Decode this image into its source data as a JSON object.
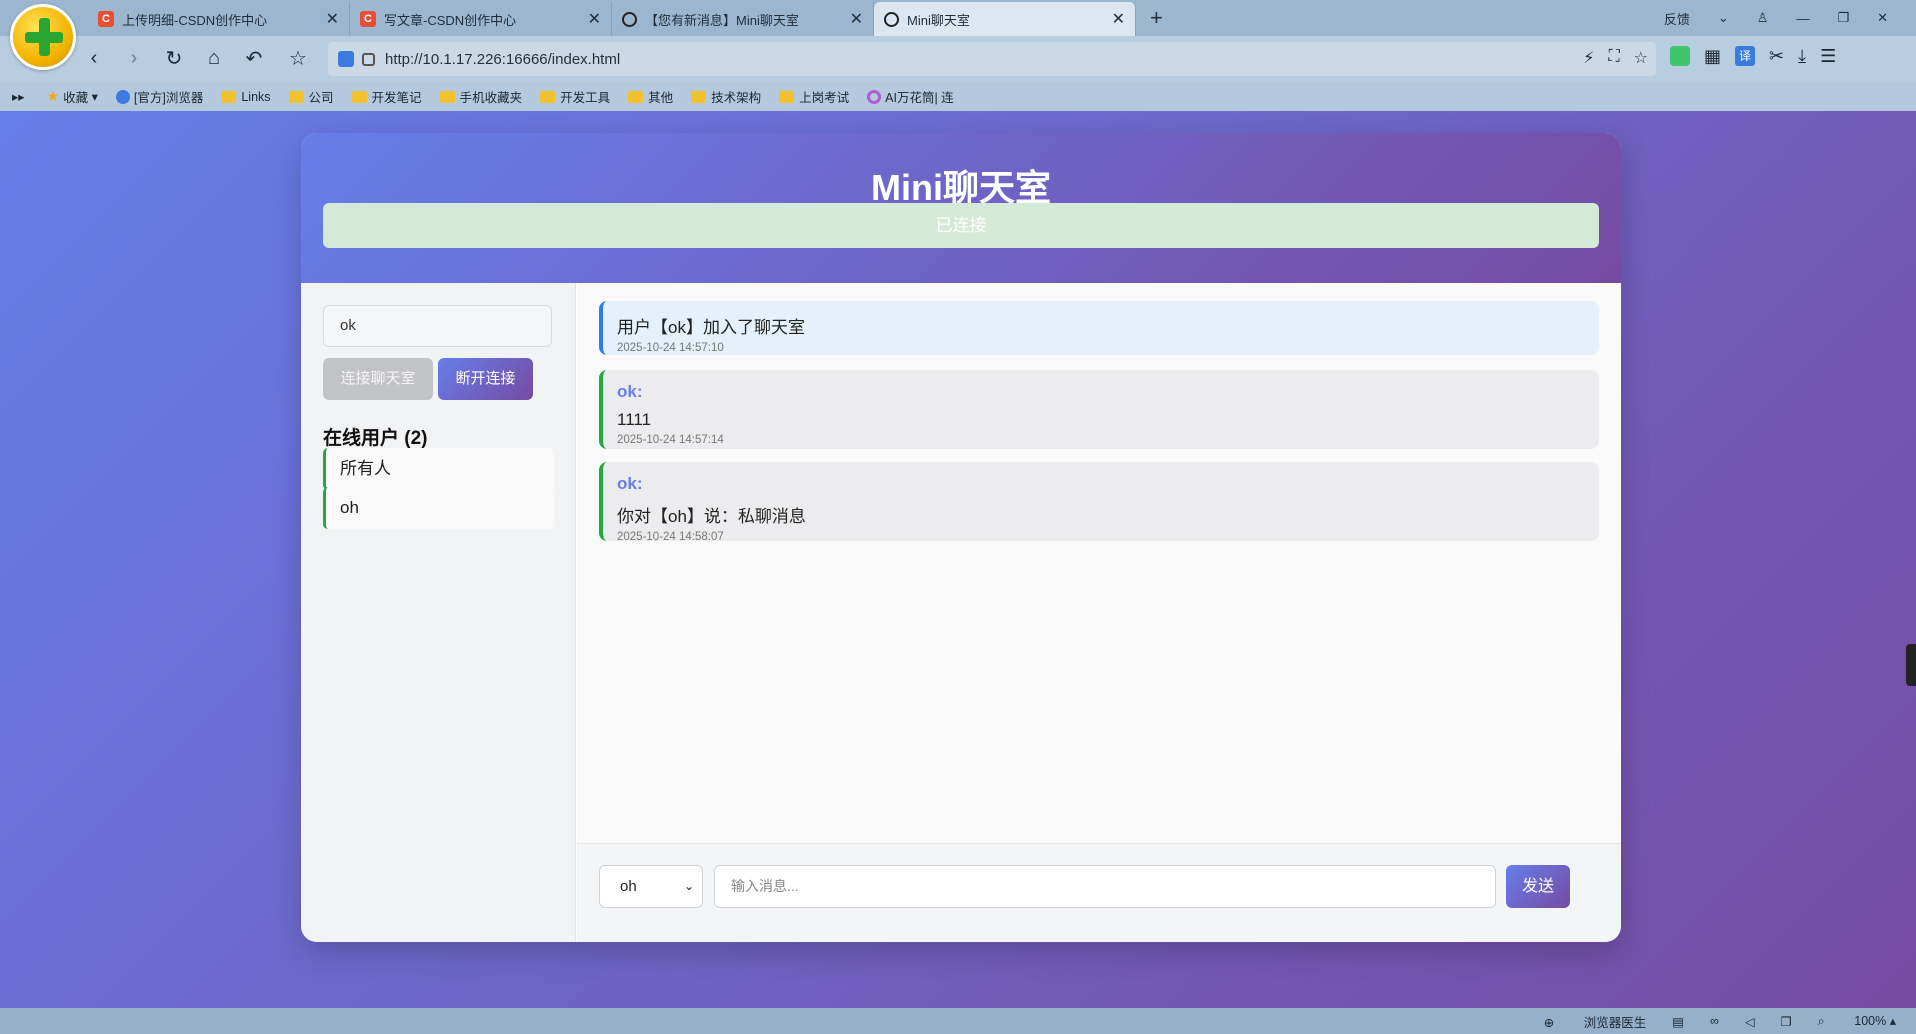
{
  "browser": {
    "tabs": [
      {
        "title": "上传明细-CSDN创作中心",
        "icon": "csdn-icon"
      },
      {
        "title": "写文章-CSDN创作中心",
        "icon": "csdn-icon"
      },
      {
        "title": "【您有新消息】Mini聊天室",
        "icon": "globe-icon"
      },
      {
        "title": "Mini聊天室",
        "icon": "globe-icon",
        "active": true
      }
    ],
    "window_controls": {
      "feedback": "反馈"
    },
    "address": "http://10.1.17.226:16666/index.html",
    "bookmarks": [
      {
        "label": "收藏",
        "icon": "star-icon"
      },
      {
        "label": "[官方]浏览器",
        "icon": "ie-icon"
      },
      {
        "label": "Links",
        "icon": "folder-icon"
      },
      {
        "label": "公司",
        "icon": "folder-icon"
      },
      {
        "label": "开发笔记",
        "icon": "folder-icon"
      },
      {
        "label": "手机收藏夹",
        "icon": "folder-icon"
      },
      {
        "label": "开发工具",
        "icon": "folder-icon"
      },
      {
        "label": "其他",
        "icon": "folder-icon"
      },
      {
        "label": "技术架构",
        "icon": "folder-icon"
      },
      {
        "label": "上岗考试",
        "icon": "folder-icon"
      },
      {
        "label": "AI万花筒| 连",
        "icon": "ai-icon"
      }
    ],
    "status": {
      "doctor": "浏览器医生",
      "zoom": "100%"
    }
  },
  "app": {
    "title": "Mini聊天室",
    "connection_status": "已连接",
    "username_value": "ok",
    "connect_label": "连接聊天室",
    "disconnect_label": "断开连接",
    "users_heading": "在线用户 (2)",
    "users": [
      "所有人",
      "oh"
    ],
    "messages": [
      {
        "type": "system",
        "text": "用户【ok】加入了聊天室",
        "time": "2025-10-24 14:57:10"
      },
      {
        "type": "user",
        "sender": "ok:",
        "text": "1111",
        "time": "2025-10-24 14:57:14"
      },
      {
        "type": "user",
        "sender": "ok:",
        "text": "你对【oh】说：私聊消息",
        "time": "2025-10-24 14:58:07"
      }
    ],
    "target_selected": "oh",
    "input_placeholder": "输入消息...",
    "send_label": "发送"
  },
  "colors": {
    "gradient_start": "#667eea",
    "gradient_end": "#764ba2",
    "system_border": "#2b7de9",
    "user_border": "#28a745"
  }
}
